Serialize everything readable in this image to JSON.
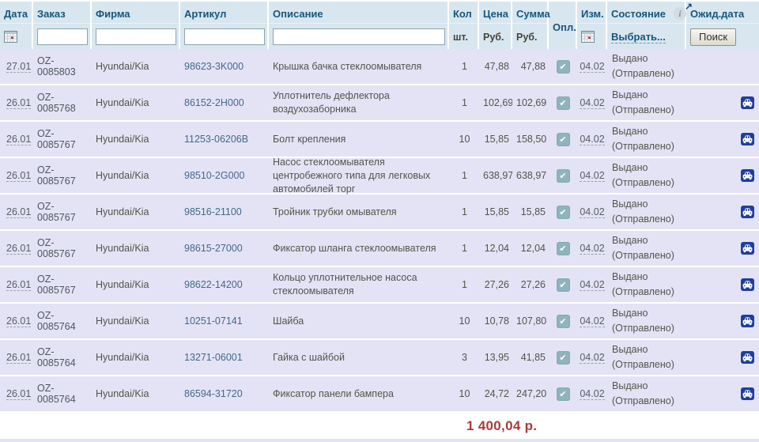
{
  "header": {
    "date": {
      "label": "Дата"
    },
    "order": {
      "label": "Заказ",
      "filter_value": ""
    },
    "firm": {
      "label": "Фирма",
      "filter_value": ""
    },
    "article": {
      "label": "Артикул",
      "filter_value": ""
    },
    "desc": {
      "label": "Описание",
      "filter_value": ""
    },
    "qty": {
      "label": "Кол",
      "sub": "шт."
    },
    "price": {
      "label": "Цена",
      "sub": "Руб."
    },
    "sum": {
      "label": "Сумма",
      "sub": "Руб."
    },
    "paid": {
      "label": "Опл."
    },
    "izm": {
      "label": "Изм."
    },
    "status": {
      "label": "Состояние",
      "select_label": "Выбрать..."
    },
    "expected": {
      "label": "Ожид.дата",
      "search_button": "Поиск"
    }
  },
  "icons": {
    "info": "i",
    "external_arrow": "↗",
    "check": "✔"
  },
  "rows": [
    {
      "date": "27.01",
      "order": "OZ-0085803",
      "firm": "Hyundai/Kia",
      "article": "98623-3K000",
      "desc": "Крышка бачка стеклоомывателя",
      "qty": "1",
      "price": "47,88",
      "sum": "47,88",
      "paid": true,
      "izm": "04.02",
      "status1": "Выдано",
      "status2": "(Отправлено)",
      "car": false
    },
    {
      "date": "26.01",
      "order": "OZ-0085768",
      "firm": "Hyundai/Kia",
      "article": "86152-2H000",
      "desc": "Уплотнитель дефлектора воздухозаборника",
      "qty": "1",
      "price": "102,69",
      "sum": "102,69",
      "paid": true,
      "izm": "04.02",
      "status1": "Выдано",
      "status2": "(Отправлено)",
      "car": true
    },
    {
      "date": "26.01",
      "order": "OZ-0085767",
      "firm": "Hyundai/Kia",
      "article": "11253-06206B",
      "desc": "Болт крепления",
      "qty": "10",
      "price": "15,85",
      "sum": "158,50",
      "paid": true,
      "izm": "04.02",
      "status1": "Выдано",
      "status2": "(Отправлено)",
      "car": true
    },
    {
      "date": "26.01",
      "order": "OZ-0085767",
      "firm": "Hyundai/Kia",
      "article": "98510-2G000",
      "desc": "Насос стеклоомывателя центробежного типа для легковых автомобилей торг",
      "qty": "1",
      "price": "638,97",
      "sum": "638,97",
      "paid": true,
      "izm": "04.02",
      "status1": "Выдано",
      "status2": "(Отправлено)",
      "car": true
    },
    {
      "date": "26.01",
      "order": "OZ-0085767",
      "firm": "Hyundai/Kia",
      "article": "98516-21100",
      "desc": "Тройник трубки омывателя",
      "qty": "1",
      "price": "15,85",
      "sum": "15,85",
      "paid": true,
      "izm": "04.02",
      "status1": "Выдано",
      "status2": "(Отправлено)",
      "car": true
    },
    {
      "date": "26.01",
      "order": "OZ-0085767",
      "firm": "Hyundai/Kia",
      "article": "98615-27000",
      "desc": "Фиксатор шланга стеклоомывателя",
      "qty": "1",
      "price": "12,04",
      "sum": "12,04",
      "paid": true,
      "izm": "04.02",
      "status1": "Выдано",
      "status2": "(Отправлено)",
      "car": true
    },
    {
      "date": "26.01",
      "order": "OZ-0085767",
      "firm": "Hyundai/Kia",
      "article": "98622-14200",
      "desc": "Кольцо уплотнительное насоса стеклоомывателя",
      "qty": "1",
      "price": "27,26",
      "sum": "27,26",
      "paid": true,
      "izm": "04.02",
      "status1": "Выдано",
      "status2": "(Отправлено)",
      "car": true
    },
    {
      "date": "26.01",
      "order": "OZ-0085764",
      "firm": "Hyundai/Kia",
      "article": "10251-07141",
      "desc": "Шайба",
      "qty": "10",
      "price": "10,78",
      "sum": "107,80",
      "paid": true,
      "izm": "04.02",
      "status1": "Выдано",
      "status2": "(Отправлено)",
      "car": true
    },
    {
      "date": "26.01",
      "order": "OZ-0085764",
      "firm": "Hyundai/Kia",
      "article": "13271-06001",
      "desc": "Гайка с шайбой",
      "qty": "3",
      "price": "13,95",
      "sum": "41,85",
      "paid": true,
      "izm": "04.02",
      "status1": "Выдано",
      "status2": "(Отправлено)",
      "car": true
    },
    {
      "date": "26.01",
      "order": "OZ-0085764",
      "firm": "Hyundai/Kia",
      "article": "86594-31720",
      "desc": "Фиксатор панели бампера",
      "qty": "10",
      "price": "24,72",
      "sum": "247,20",
      "paid": true,
      "izm": "04.02",
      "status1": "Выдано",
      "status2": "(Отправлено)",
      "car": true
    }
  ],
  "total": "1 400,04 р.",
  "colors": {
    "header_bg": "#d8e6ef",
    "row_bg": "#e4e3f5",
    "header_label": "#17567c",
    "article_text": "#44688c",
    "total_text": "#a93b3b",
    "checkbox_bg": "#8fb4bc",
    "car_icon_bg": "#1e3e9e"
  }
}
